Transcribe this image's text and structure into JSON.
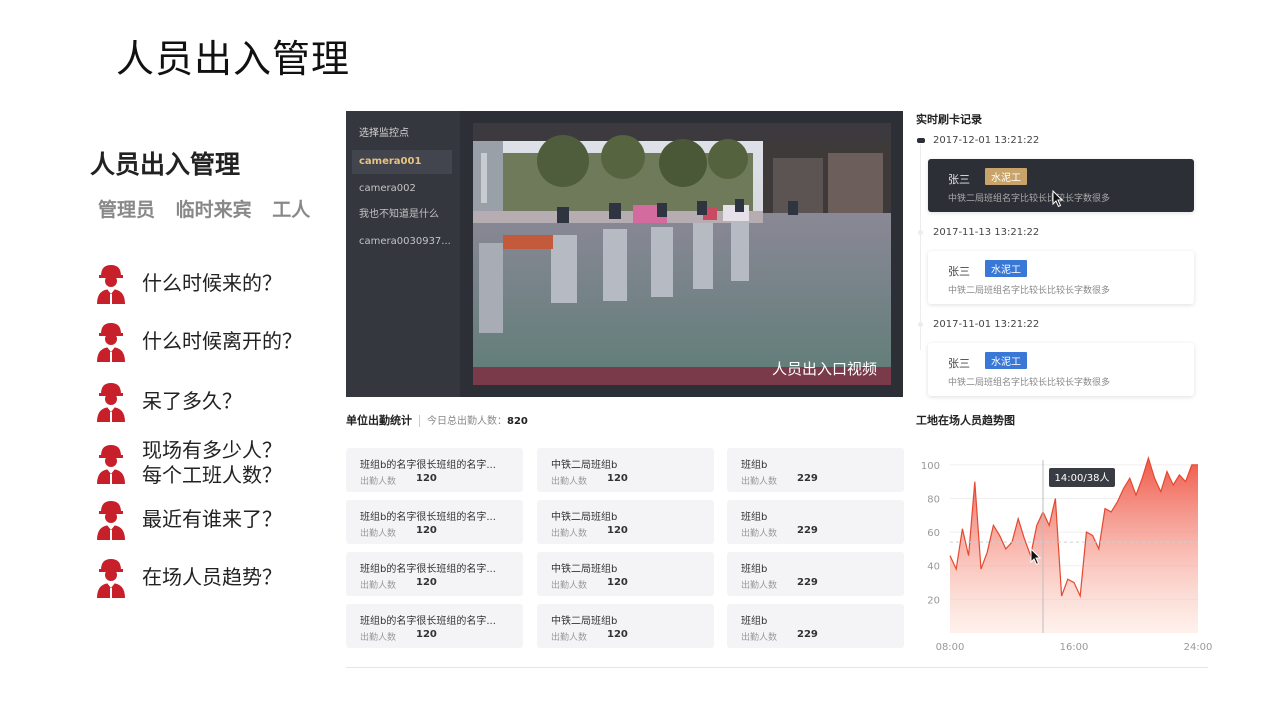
{
  "page_title": "人员出入管理",
  "left_panel": {
    "heading": "人员出入管理",
    "roles": [
      "管理员",
      "临时来宾",
      "工人"
    ],
    "questions": [
      {
        "icon": "worker-icon",
        "text": "什么时候来的？"
      },
      {
        "icon": "worker-icon",
        "text": "什么时候离开的？"
      },
      {
        "icon": "worker-icon",
        "text": "呆了多久？"
      },
      {
        "icon": "worker-icon",
        "text": "现场有多少人？\n每个工班人数？"
      },
      {
        "icon": "worker-icon",
        "text": "最近有谁来了？"
      },
      {
        "icon": "worker-icon",
        "text": "在场人员趋势？"
      }
    ]
  },
  "monitor": {
    "title": "选择监控点",
    "cameras": [
      {
        "label": "camera001",
        "active": true
      },
      {
        "label": "camera002",
        "active": false
      },
      {
        "label": "我也不知道是什么",
        "active": false
      },
      {
        "label": "camera0030937...",
        "active": false
      }
    ],
    "video_caption": "人员出入口视频"
  },
  "attendance": {
    "title": "单位出勤统计",
    "total_label": "今日总出勤人数：",
    "total_value": "820",
    "count_label": "出勤人数",
    "cards": [
      {
        "name": "班组b的名字很长班组的名字...",
        "count": "120"
      },
      {
        "name": "中铁二局班组b",
        "count": "120"
      },
      {
        "name": "班组b",
        "count": "229"
      },
      {
        "name": "班组b的名字很长班组的名字...",
        "count": "120"
      },
      {
        "name": "中铁二局班组b",
        "count": "120"
      },
      {
        "name": "班组b",
        "count": "229"
      },
      {
        "name": "班组b的名字很长班组的名字...",
        "count": "120"
      },
      {
        "name": "中铁二局班组b",
        "count": "120"
      },
      {
        "name": "班组b",
        "count": "229"
      },
      {
        "name": "班组b的名字很长班组的名字...",
        "count": "120"
      },
      {
        "name": "中铁二局班组b",
        "count": "120"
      },
      {
        "name": "班组b",
        "count": "229"
      }
    ]
  },
  "realtime": {
    "title": "实时刷卡记录",
    "records": [
      {
        "time": "2017-12-01 13:21:22",
        "name": "张三",
        "tag": "水泥工",
        "tag_color": "#c9a46a",
        "desc": "中铁二局班组名字比较长比较长字数很多",
        "highlight": true
      },
      {
        "time": "2017-11-13 13:21:22",
        "name": "张三",
        "tag": "水泥工",
        "tag_color": "#3a78d8",
        "desc": "中铁二局班组名字比较长比较长字数很多",
        "highlight": false
      },
      {
        "time": "2017-11-01 13:21:22",
        "name": "张三",
        "tag": "水泥工",
        "tag_color": "#3a78d8",
        "desc": "中铁二局班组名字比较长比较长字数很多",
        "highlight": false
      }
    ]
  },
  "trend": {
    "title": "工地在场人员趋势图",
    "tooltip": "14:00/38人"
  },
  "chart_data": {
    "type": "area",
    "title": "工地在场人员趋势图",
    "x_ticks": [
      "08:00",
      "16:00",
      "24:00"
    ],
    "y_ticks": [
      100,
      80,
      60,
      40,
      20
    ],
    "xlim": [
      8,
      24
    ],
    "ylim": [
      0,
      110
    ],
    "grid": true,
    "series": [
      {
        "x": [
          8,
          8.4,
          8.8,
          9.2,
          9.6,
          10.0,
          10.4,
          10.8,
          11.2,
          11.6,
          12.0,
          12.4,
          12.8,
          13.2,
          13.6,
          14.0,
          14.4,
          14.8,
          15.2,
          15.6,
          16.0,
          16.4,
          16.8,
          17.2,
          17.6,
          18.0,
          18.4,
          18.8,
          19.2,
          19.6,
          20.0,
          20.4,
          20.8,
          21.2,
          21.6,
          22.0,
          22.4,
          22.8,
          23.2,
          23.6,
          24.0
        ],
        "y": [
          46,
          38,
          62,
          46,
          90,
          38,
          48,
          64,
          58,
          50,
          54,
          68,
          56,
          46,
          64,
          72,
          64,
          80,
          22,
          32,
          30,
          22,
          60,
          58,
          50,
          74,
          72,
          78,
          86,
          92,
          82,
          92,
          104,
          92,
          84,
          96,
          88,
          94,
          90,
          100,
          100
        ]
      }
    ],
    "highlight_x": 14.0,
    "highlight_label": "14:00/38人",
    "reference_line_y": 54
  }
}
